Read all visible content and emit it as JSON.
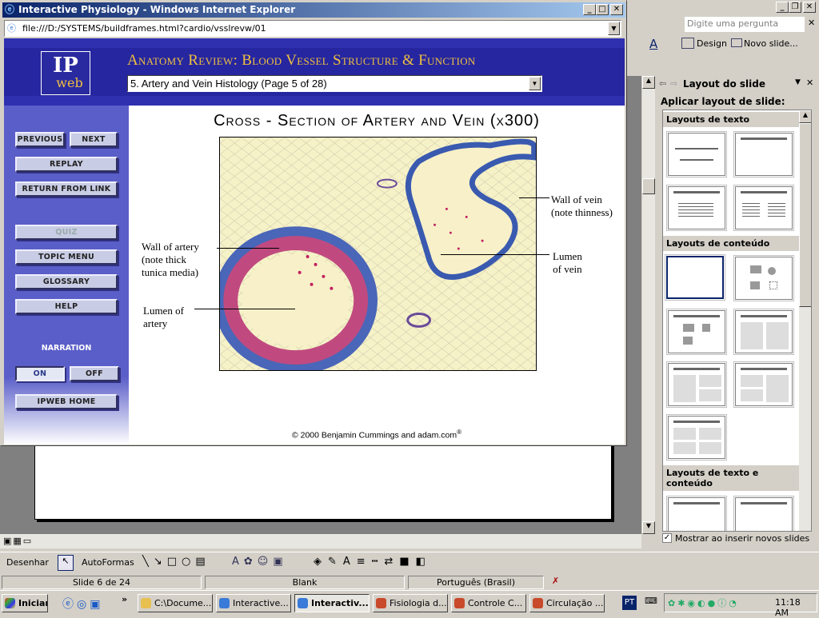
{
  "ppt": {
    "help_placeholder": "Digite uma pergunta",
    "toolbar": {
      "design": "Design",
      "new_slide": "Novo slide..."
    },
    "task_pane": {
      "title": "Layout do slide",
      "apply_label": "Aplicar layout de slide:",
      "sections": [
        "Layouts de texto",
        "Layouts de conteúdo",
        "Layouts de texto e conteúdo"
      ],
      "show_on_insert": "Mostrar ao inserir novos slides",
      "show_on_insert_checked": true
    },
    "draw_toolbar": {
      "draw": "Desenhar",
      "autoshapes": "AutoFormas"
    },
    "status": {
      "slide": "Slide 6 de 24",
      "design": "Blank",
      "language": "Português (Brasil)"
    }
  },
  "taskbar": {
    "start": "Iniciar",
    "items": [
      "C:\\Docume...",
      "Interactive...",
      "Interactiv...",
      "Fisiologia d...",
      "Controle C...",
      "Circulação ..."
    ],
    "active_index": 2,
    "lang": "PT",
    "clock": "11:18 AM"
  },
  "ie": {
    "title": "Interactive Physiology - Windows Internet Explorer",
    "address": "file:///D:/SYSTEMS/buildframes.html?cardio/vsslrevw/01"
  },
  "ip": {
    "logo_top": "IP",
    "logo_bottom": "web",
    "app_title": "Anatomy Review: Blood Vessel Structure & Function",
    "topic_select": "5. Artery and Vein Histology (Page 5 of 28)",
    "nav": {
      "previous": "PREVIOUS",
      "next": "NEXT",
      "replay": "REPLAY",
      "return": "RETURN FROM LINK",
      "quiz": "QUIZ",
      "topic_menu": "TOPIC MENU",
      "glossary": "GLOSSARY",
      "help": "HELP",
      "narration": "NARRATION",
      "on": "ON",
      "off": "OFF",
      "home": "IPWEB HOME"
    },
    "main_title": "Cross - Section of Artery and Vein (x300)",
    "labels": {
      "wall_artery": [
        "Wall of artery",
        "(note thick",
        "tunica media)"
      ],
      "lumen_artery": [
        "Lumen of",
        "artery"
      ],
      "wall_vein": [
        "Wall of vein",
        "(note thinness)"
      ],
      "lumen_vein": [
        "Lumen",
        "of vein"
      ]
    },
    "copyright": "© 2000 Benjamin Cummings and adam.com",
    "copyright_mark": "®"
  }
}
